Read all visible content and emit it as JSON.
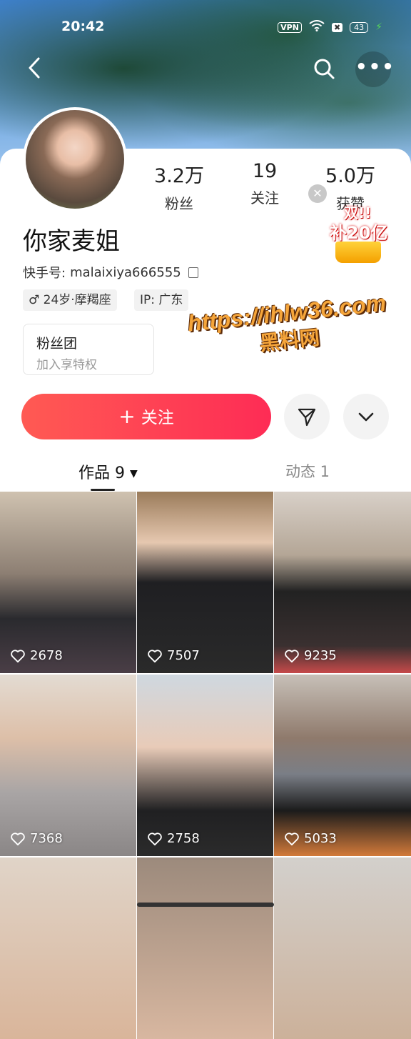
{
  "status_bar": {
    "time": "20:42",
    "vpn": "VPN",
    "battery": "43"
  },
  "profile": {
    "stats": [
      {
        "value": "3.2万",
        "label": "粉丝"
      },
      {
        "value": "19",
        "label": "关注"
      },
      {
        "value": "5.0万",
        "label": "获赞"
      }
    ],
    "name": "你家麦姐",
    "id_label": "快手号:",
    "id_value": "malaixiya666555",
    "tags": [
      "♂ 24岁·摩羯座",
      "IP: 广东"
    ],
    "fan_club": {
      "title": "粉丝团",
      "subtitle": "加入享特权"
    }
  },
  "promo": {
    "line1": "双!!",
    "line2": "补20亿"
  },
  "watermark": {
    "line1": "https://ihlw36.com",
    "line2": "黑料网"
  },
  "actions": {
    "follow_label": "关注"
  },
  "tabs": [
    {
      "label": "作品 9"
    },
    {
      "label": "动态 1"
    }
  ],
  "videos": [
    {
      "likes": "2678"
    },
    {
      "likes": "7507"
    },
    {
      "likes": "9235"
    },
    {
      "likes": "7368"
    },
    {
      "likes": "2758"
    },
    {
      "likes": "5033"
    }
  ],
  "icons": {
    "back": "chevron-left-icon",
    "search": "search-icon",
    "more": "more-dots-icon",
    "copy": "copy-icon",
    "share": "send-icon",
    "expand": "chevron-down-icon",
    "heart": "heart-outline-icon"
  },
  "colors": {
    "follow_start": "#ff5a53",
    "follow_end": "#fe2c55"
  }
}
